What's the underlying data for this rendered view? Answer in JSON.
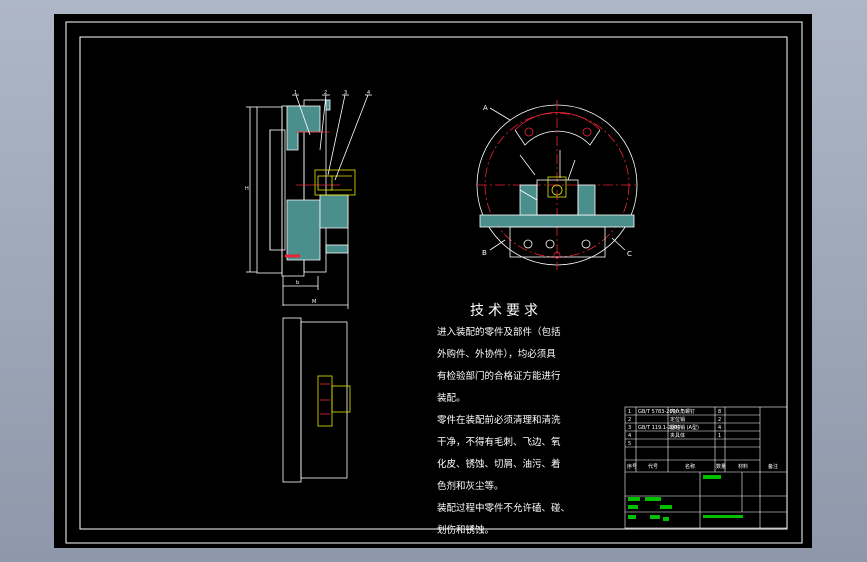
{
  "drawing": {
    "requirements_title": "技术要求",
    "requirements": [
      "进入装配的零件及部件（包括",
      "外购件、外协件），均必须具",
      "有检验部门的合格证方能进行",
      "装配。",
      "零件在装配前必须清理和清洗",
      "干净，不得有毛刺、飞边、氧",
      "化皮、锈蚀、切屑、油污、着",
      "色剂和灰尘等。",
      "装配过程中零件不允许磕、碰、",
      "划伤和锈蚀。"
    ],
    "part_numbers": [
      "1",
      "2",
      "3",
      "4"
    ],
    "circle_labels": {
      "a": "A",
      "b": "B",
      "c": "C"
    },
    "side_dims": {
      "height": "H",
      "width_small": "b",
      "width_large": "M"
    },
    "title_block": {
      "header": [
        "序号",
        "代号",
        "名称",
        "数量",
        "材料",
        "备注"
      ],
      "rows": [
        [
          "1",
          "GB/T 5783-2000",
          "内六角螺钉",
          "8",
          "",
          ""
        ],
        [
          "2",
          "",
          "定位销",
          "2",
          "",
          ""
        ],
        [
          "3",
          "GB/T 119.1-2000",
          "圆柱销 (A型)",
          "4",
          "",
          ""
        ],
        [
          "4",
          "",
          "夹具体",
          "1",
          "",
          ""
        ],
        [
          "5",
          "",
          "",
          "",
          "",
          ""
        ]
      ]
    }
  }
}
